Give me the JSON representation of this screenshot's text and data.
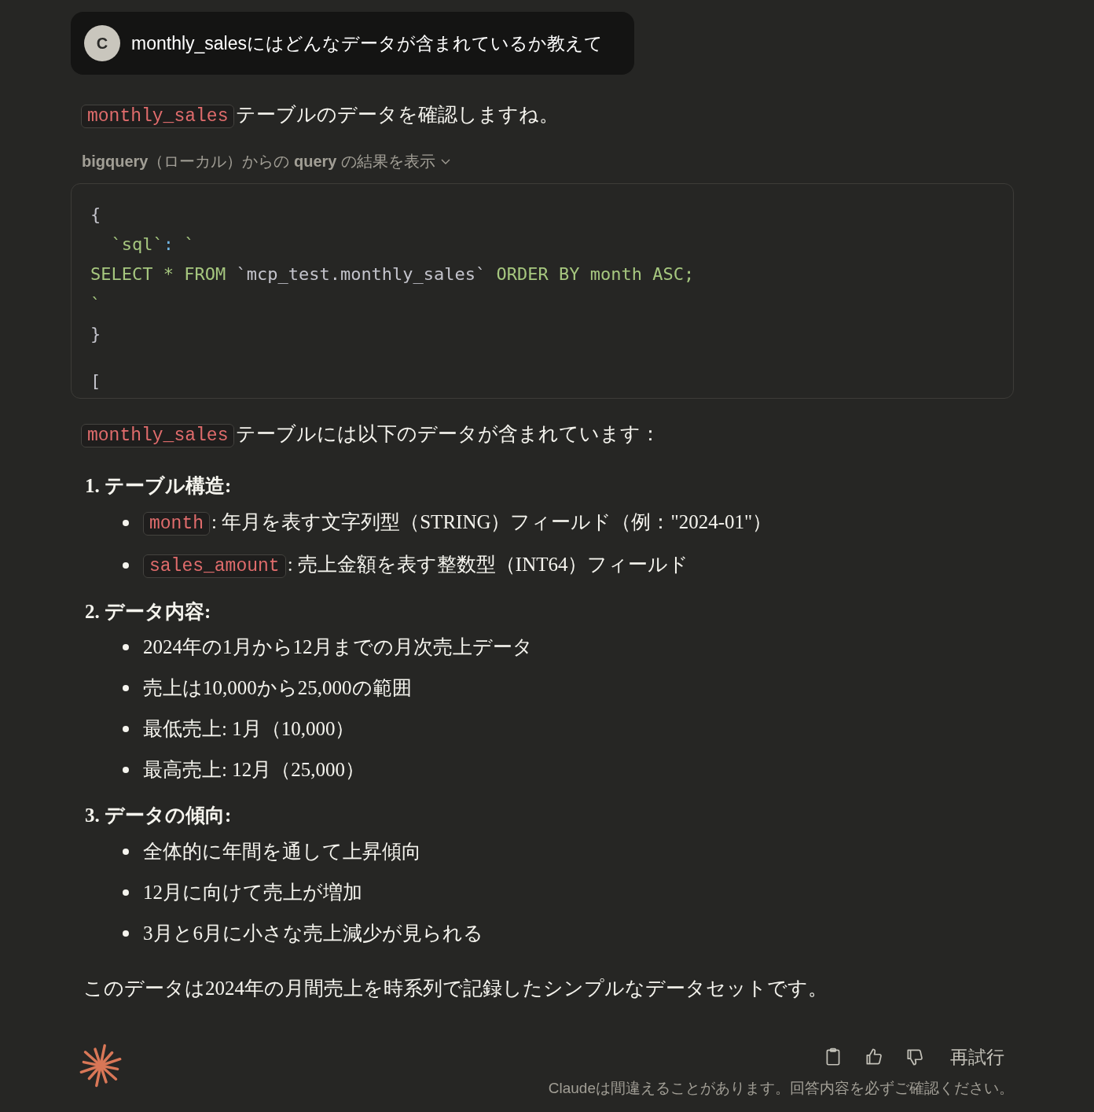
{
  "user_message": {
    "avatar": "C",
    "text": "monthly_salesにはどんなデータが含まれているか教えて"
  },
  "intro": [
    {
      "kind": "code",
      "text": "monthly_sales"
    },
    {
      "kind": "text",
      "text": "テーブルのデータを確認しますね。"
    }
  ],
  "tool_call": {
    "text": "**bigquery**（ローカル）からの **query** の結果を表示",
    "expanded": false
  },
  "code_lines": [
    [
      {
        "kind": "plain",
        "text": "{"
      }
    ],
    [
      {
        "kind": "string",
        "text": "  `sql`"
      },
      {
        "kind": "key",
        "text": ":"
      },
      {
        "kind": "string",
        "text": " `"
      }
    ],
    [
      {
        "kind": "string",
        "text": "SELECT * FROM "
      },
      {
        "kind": "plain",
        "text": "`mcp_test.monthly_sales`"
      },
      {
        "kind": "string",
        "text": " ORDER BY month ASC;"
      }
    ],
    [
      {
        "kind": "string",
        "text": "`"
      }
    ],
    [
      {
        "kind": "plain",
        "text": "}"
      }
    ],
    [
      {
        "kind": "plain",
        "text": "["
      }
    ]
  ],
  "summary": [
    {
      "kind": "code",
      "text": "monthly_sales"
    },
    {
      "kind": "text",
      "text": "テーブルには以下のデータが含まれています："
    }
  ],
  "sections": [
    {
      "number": "1.",
      "title": "テーブル構造:",
      "bullets": [
        [
          {
            "kind": "code",
            "text": "month"
          },
          {
            "kind": "text",
            "text": ": 年月を表す文字列型（STRING）フィールド（例：\"2024-01\"）"
          }
        ],
        [
          {
            "kind": "code",
            "text": "sales_amount"
          },
          {
            "kind": "text",
            "text": ": 売上金額を表す整数型（INT64）フィールド"
          }
        ]
      ]
    },
    {
      "number": "2.",
      "title": "データ内容:",
      "bullets": [
        [
          {
            "kind": "text",
            "text": "2024年の1月から12月までの月次売上データ"
          }
        ],
        [
          {
            "kind": "text",
            "text": "売上は10,000から25,000の範囲"
          }
        ],
        [
          {
            "kind": "text",
            "text": "最低売上: 1月（10,000）"
          }
        ],
        [
          {
            "kind": "text",
            "text": "最高売上: 12月（25,000）"
          }
        ]
      ]
    },
    {
      "number": "3.",
      "title": "データの傾向:",
      "bullets": [
        [
          {
            "kind": "text",
            "text": "全体的に年間を通して上昇傾向"
          }
        ],
        [
          {
            "kind": "text",
            "text": "12月に向けて売上が増加"
          }
        ],
        [
          {
            "kind": "text",
            "text": "3月と6月に小さな売上減少が見られる"
          }
        ]
      ]
    }
  ],
  "conclusion": "このデータは2024年の月間売上を時系列で記録したシンプルなデータセットです。",
  "retry_label": "再試行",
  "disclaimer": "Claudeは間違えることがあります。回答内容を必ずご確認ください。"
}
